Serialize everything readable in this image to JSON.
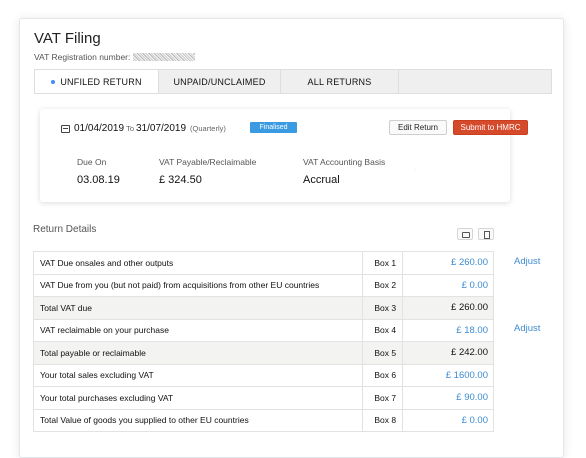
{
  "page": {
    "title": "VAT Filing",
    "registration_label": "VAT Registration number:"
  },
  "tabs": [
    {
      "label": "UNFILED RETURN",
      "active": true
    },
    {
      "label": "UNPAID/UNCLAIMED",
      "active": false
    },
    {
      "label": "ALL RETURNS",
      "active": false
    }
  ],
  "summary": {
    "start_date": "01/04/2019",
    "to_label": "To",
    "end_date": "31/07/2019",
    "period_type": "(Quarterly)",
    "status_badge": "Finalised",
    "edit_label": "Edit Return",
    "submit_label": "Submit to HMRC",
    "due_on_label": "Due On",
    "due_on_value": "03.08.19",
    "vat_payable_label": "VAT Payable/Reclaimable",
    "vat_payable_value": "£ 324.50",
    "basis_label": "VAT Accounting Basis",
    "basis_value": "Accrual",
    "colors": {
      "badge": "#3b9be2",
      "submit": "#d64a2c"
    }
  },
  "return_details": {
    "title": "Return Details",
    "adjust_label": "Adjust",
    "rows": [
      {
        "desc": "VAT Due onsales and other outputs",
        "box": "Box 1",
        "amount": "£ 260.00"
      },
      {
        "desc": "VAT Due from you (but not paid) from acquisitions from other EU countries",
        "box": "Box 2",
        "amount": "£ 0.00"
      },
      {
        "desc": "Total VAT due",
        "box": "Box 3",
        "amount": "£ 260.00"
      },
      {
        "desc": "VAT reclaimable on your purchase",
        "box": "Box 4",
        "amount": "£ 18.00"
      },
      {
        "desc": "Total payable or reclaimable",
        "box": "Box 5",
        "amount": "£ 242.00"
      },
      {
        "desc": "Your total sales excluding VAT",
        "box": "Box 6",
        "amount": "£ 1600.00"
      },
      {
        "desc": "Your total purchases excluding VAT",
        "box": "Box 7",
        "amount": "£ 90.00"
      },
      {
        "desc": "Total Value of goods you supplied to other EU countries",
        "box": "Box 8",
        "amount": "£ 0.00"
      }
    ]
  }
}
